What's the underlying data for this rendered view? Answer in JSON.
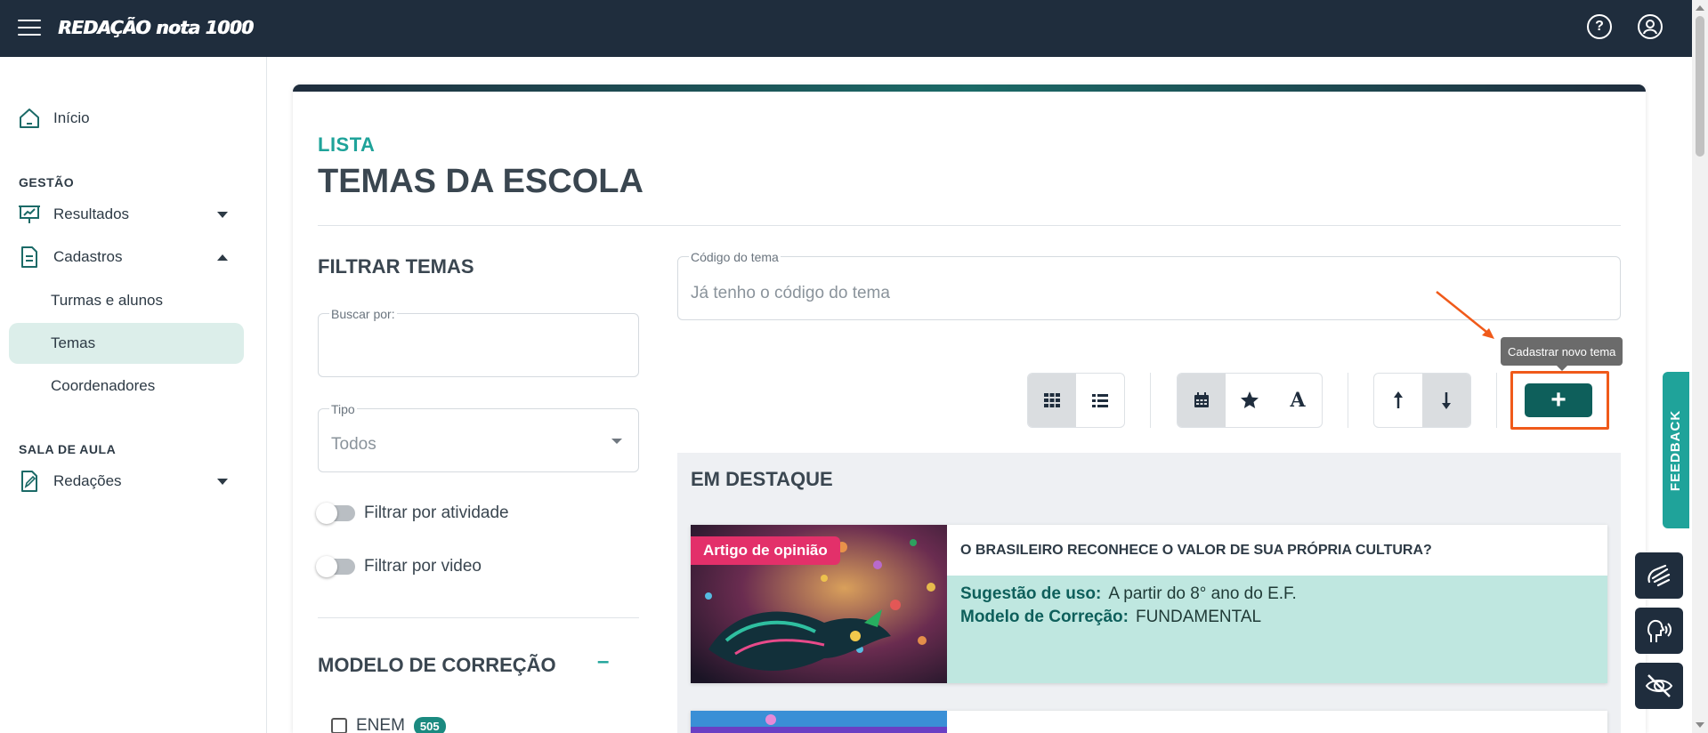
{
  "app": {
    "logo_text": "REDAÇÃO nota 1000",
    "help_icon": "help-circle-icon",
    "user_icon": "user-circle-icon"
  },
  "sidebar": {
    "inicio": "Início",
    "section_gestao": "GESTÃO",
    "resultados": "Resultados",
    "cadastros": "Cadastros",
    "turmas": "Turmas e alunos",
    "temas": "Temas",
    "coordenadores": "Coordenadores",
    "section_sala": "SALA DE AULA",
    "redacoes": "Redações"
  },
  "main": {
    "kicker": "LISTA",
    "title": "TEMAS DA ESCOLA",
    "filter_title": "FILTRAR TEMAS",
    "buscar_label": "Buscar por:",
    "buscar_value": "",
    "tipo_label": "Tipo",
    "tipo_value": "Todos",
    "toggle_atividade": "Filtrar por atividade",
    "toggle_video": "Filtrar por video",
    "modelo_title": "MODELO DE CORREÇÃO",
    "modelo_toggle": "–",
    "enem_label": "ENEM",
    "enem_count": "505",
    "codigo_label": "Código do tema",
    "codigo_placeholder": "Já tenho o código do tema",
    "tooltip": "Cadastrar novo tema",
    "add_symbol": "+",
    "destaque_title": "EM DESTAQUE",
    "theme": {
      "tag": "Artigo de opinião",
      "title": "O BRASILEIRO RECONHECE O VALOR DE SUA PRÓPRIA CULTURA?",
      "sugestao_label": "Sugestão de uso:",
      "sugestao_value": "A partir do 8° ano do E.F.",
      "modelo_label": "Modelo de Correção:",
      "modelo_value": "FUNDAMENTAL"
    }
  },
  "feedback": "FEEDBACK",
  "colors": {
    "topbar": "#1f2d3d",
    "accent": "#1fa39a",
    "primary_button": "#0e5f5b",
    "highlight": "#f05a1a",
    "tag": "#e3306a"
  }
}
